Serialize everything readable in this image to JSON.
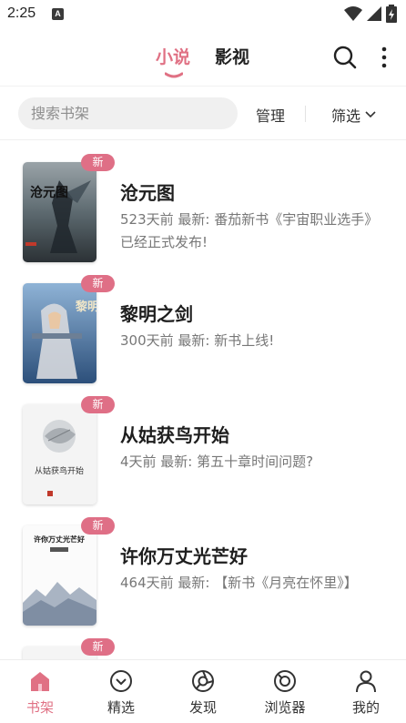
{
  "status_bar": {
    "time": "2:25",
    "notification_letter": "A"
  },
  "header": {
    "tabs": [
      {
        "label": "小说",
        "active": true
      },
      {
        "label": "影视",
        "active": false
      }
    ]
  },
  "toolbar": {
    "search_placeholder": "搜索书架",
    "manage_label": "管理",
    "filter_label": "筛选"
  },
  "books": [
    {
      "title": "沧元图",
      "meta": "523天前 最新: 番茄新书《宇宙职业选手》已经正式发布!",
      "badge": "新"
    },
    {
      "title": "黎明之剑",
      "meta": "300天前 最新: 新书上线!",
      "badge": "新"
    },
    {
      "title": "从姑获鸟开始",
      "meta": "4天前 最新: 第五十章时间问题?",
      "badge": "新"
    },
    {
      "title": "许你万丈光芒好",
      "meta": "464天前 最新: 【新书《月亮在怀里》】",
      "badge": "新"
    },
    {
      "title": "",
      "meta": "",
      "badge": "新"
    }
  ],
  "covers": [
    {
      "text": "沧元图"
    },
    {
      "text": "黎明之剑"
    },
    {
      "text": "从姑获鸟开始"
    },
    {
      "text": "许你万丈光芒好"
    }
  ],
  "bottom_nav": [
    {
      "label": "书架",
      "icon": "home-icon",
      "active": true
    },
    {
      "label": "精选",
      "icon": "compass-icon",
      "active": false
    },
    {
      "label": "发现",
      "icon": "discover-icon",
      "active": false
    },
    {
      "label": "浏览器",
      "icon": "browser-icon",
      "active": false
    },
    {
      "label": "我的",
      "icon": "profile-icon",
      "active": false
    }
  ],
  "colors": {
    "accent": "#e07184",
    "badge": "#df6f86"
  }
}
